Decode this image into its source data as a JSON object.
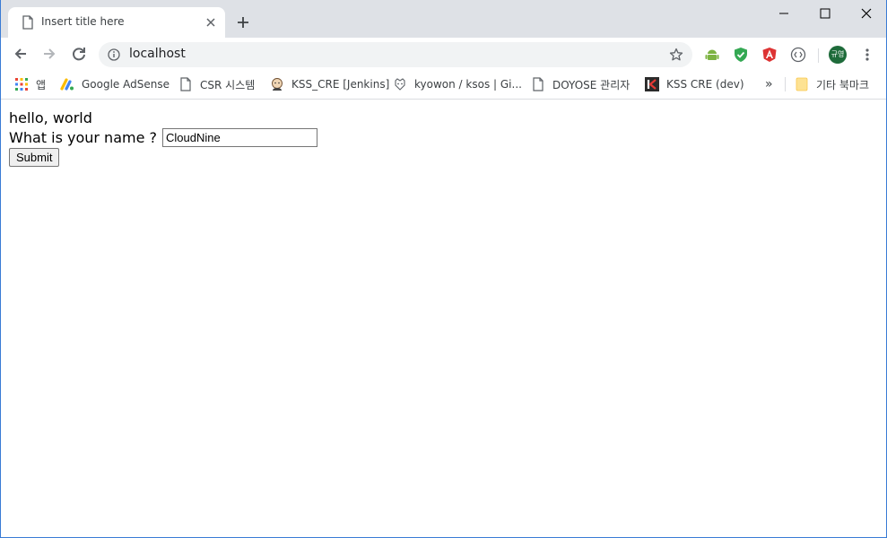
{
  "tab": {
    "title": "Insert title here"
  },
  "omnibox": {
    "url": "localhost"
  },
  "avatar": {
    "initials": "규영"
  },
  "bookmarks": [
    {
      "label": "앱",
      "icon": "apps-grid-icon"
    },
    {
      "label": "Google AdSense",
      "icon": "adsense-icon"
    },
    {
      "label": "CSR 시스템",
      "icon": "page-icon"
    },
    {
      "label": "KSS_CRE [Jenkins]",
      "icon": "jenkins-icon"
    },
    {
      "label": "kyowon / ksos | Gi...",
      "icon": "gitlab-icon"
    },
    {
      "label": "DOYOSE 관리자",
      "icon": "page-icon"
    },
    {
      "label": "KSS CRE (dev)",
      "icon": "k-logo-icon"
    }
  ],
  "bookmarks_more": "»",
  "other_bookmarks": {
    "label": "기타 북마크",
    "icon": "folder-icon"
  },
  "page": {
    "greeting": "hello, world",
    "name_label": "What is your name ?",
    "name_value": "CloudNine",
    "submit_label": "Submit"
  },
  "colors": {
    "tabstrip_bg": "#dee1e6",
    "omnibox_bg": "#f1f3f4",
    "avatar_bg": "#1e6b3a",
    "window_border": "#3a7bd5"
  }
}
